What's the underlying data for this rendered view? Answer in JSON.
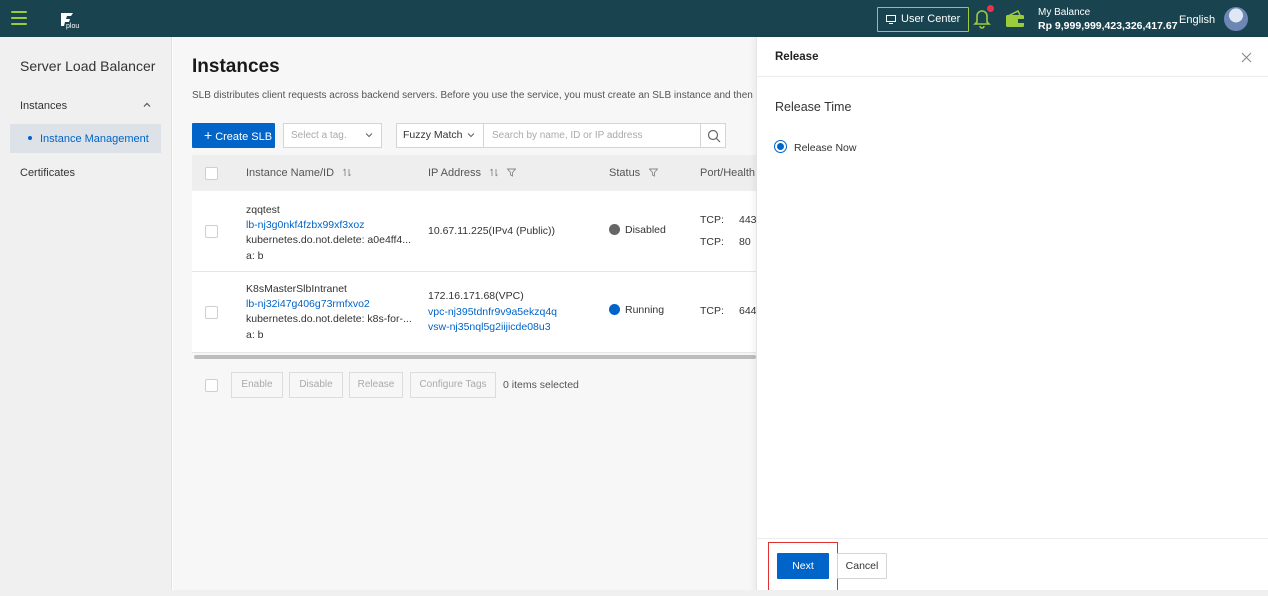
{
  "topbar": {
    "logo_text": "plou",
    "user_center": "User Center",
    "balance_label": "My Balance",
    "balance_value": "Rp 9,999,999,423,326,417.67",
    "language": "English"
  },
  "sidebar": {
    "title": "Server Load Balancer",
    "group": "Instances",
    "items": [
      {
        "label": "Instance Management",
        "active": true
      }
    ],
    "certificates": "Certificates"
  },
  "main": {
    "title": "Instances",
    "description": "SLB distributes client requests across backend servers. Before you use the service, you must create an SLB instance and then add l",
    "create_button": "Create SLB",
    "tag_placeholder": "Select a tag.",
    "match_select": "Fuzzy Match",
    "search_placeholder": "Search by name, ID or IP address",
    "columns": [
      "Instance Name/ID",
      "IP Address",
      "Status",
      "Port/Health"
    ],
    "rows": [
      {
        "name": "zqqtest",
        "id": "lb-nj3g0nkf4fzbx99xf3xoz",
        "tag1": "kubernetes.do.not.delete: a0e4ff4...",
        "tag2": "a: b",
        "ip_line1": "10.67.11.225(IPv4 (Public))",
        "status": "Disabled",
        "ports": [
          {
            "proto": "TCP:",
            "port": "443"
          },
          {
            "proto": "TCP:",
            "port": "80"
          }
        ]
      },
      {
        "name": "K8sMasterSlbIntranet",
        "id": "lb-nj32i47g406g73rmfxvo2",
        "tag1": "kubernetes.do.not.delete: k8s-for-...",
        "tag2": "a: b",
        "ip_line1": "172.16.171.68(VPC)",
        "ip_line2": "vpc-nj395tdnfr9v9a5ekzq4q",
        "ip_line3": "vsw-nj35nql5g2iijicde08u3",
        "status": "Running",
        "ports": [
          {
            "proto": "TCP:",
            "port": "644"
          }
        ]
      }
    ],
    "bulk": {
      "enable": "Enable",
      "disable": "Disable",
      "release": "Release",
      "configure_tags": "Configure Tags",
      "selected": "0 items selected"
    }
  },
  "panel": {
    "title": "Release",
    "release_time_label": "Release Time",
    "option": "Release Now",
    "next": "Next",
    "cancel": "Cancel"
  },
  "colors": {
    "topbar": "#18434f",
    "accent_green": "#9ccc3c",
    "primary_blue": "#0064c8",
    "status_disabled": "#666666",
    "status_running": "#0064c8",
    "highlight_red": "#e03030"
  }
}
